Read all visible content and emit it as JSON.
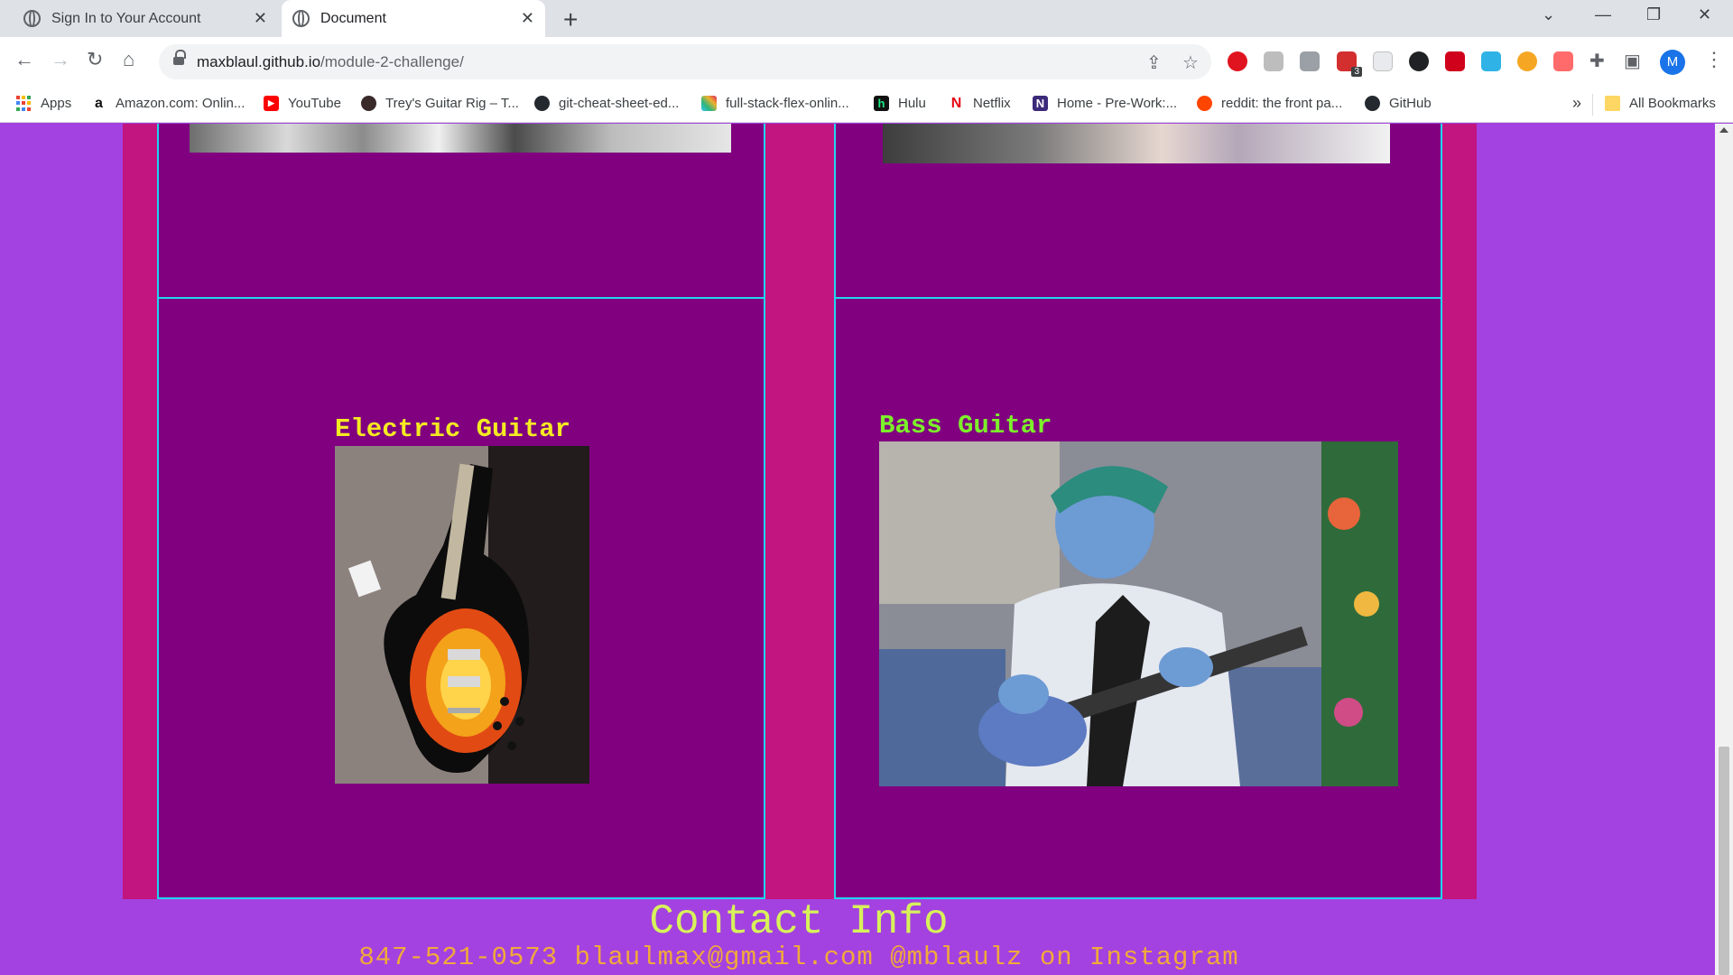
{
  "browser": {
    "tabs": [
      {
        "title": "Sign In to Your Account",
        "active": false
      },
      {
        "title": "Document",
        "active": true
      }
    ],
    "url_domain": "maxblaul.github.io",
    "url_path": "/module-2-challenge/",
    "profile_initial": "M",
    "bookmarks": [
      {
        "label": "Apps"
      },
      {
        "label": "Amazon.com: Onlin..."
      },
      {
        "label": "YouTube"
      },
      {
        "label": "Trey's Guitar Rig – T..."
      },
      {
        "label": "git-cheat-sheet-ed..."
      },
      {
        "label": "full-stack-flex-onlin..."
      },
      {
        "label": "Hulu"
      },
      {
        "label": "Netflix"
      },
      {
        "label": "Home - Pre-Work:..."
      },
      {
        "label": "reddit: the front pa..."
      },
      {
        "label": "GitHub"
      }
    ],
    "all_bookmarks_label": "All Bookmarks",
    "extension_badge": "3"
  },
  "page": {
    "cards": [
      {
        "label": "Electric Guitar",
        "image": "electric-guitar-photo"
      },
      {
        "label": "Bass Guitar",
        "image": "bass-guitar-photo"
      }
    ],
    "contact": {
      "title": "Contact Info",
      "line": "847-521-0573 blaulmax@gmail.com @mblaulz on Instagram"
    }
  },
  "colors": {
    "page_bg": "#a342e0",
    "panel": "#c2157f",
    "card_bg": "#800080",
    "card_border": "#1fd6f0",
    "header_strip": "#1f4bff",
    "electric_label": "#f4ea22",
    "bass_label": "#7cf02a",
    "contact_title": "#d7f25a",
    "contact_line": "#f1a93b"
  }
}
